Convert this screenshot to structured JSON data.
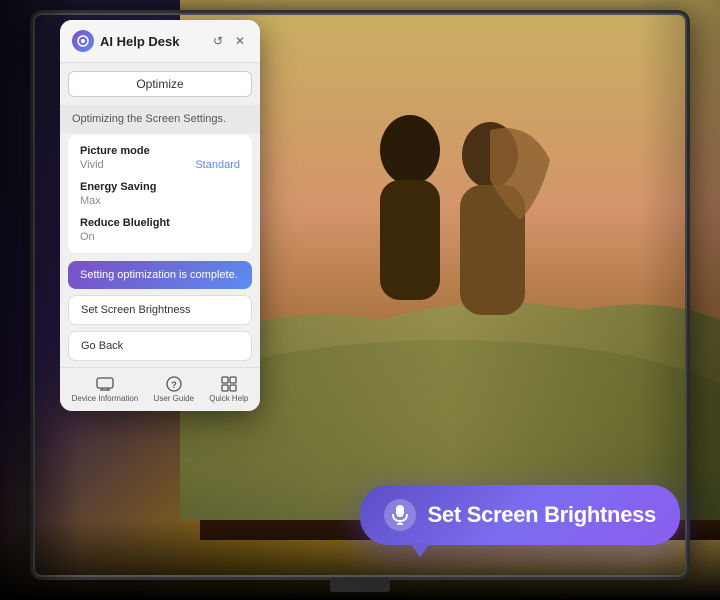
{
  "app": {
    "title": "AI Help Desk",
    "optimize_button": "Optimize",
    "optimizing_text": "Optimizing the Screen Settings.",
    "optimization_complete_text": "Setting optimization is complete."
  },
  "settings": [
    {
      "label": "Picture mode",
      "current_value": "Vivid",
      "recommended_value": "Standard"
    },
    {
      "label": "Energy Saving",
      "current_value": "Max",
      "recommended_value": null
    },
    {
      "label": "Reduce Bluelight",
      "current_value": "On",
      "recommended_value": null
    }
  ],
  "actions": [
    {
      "label": "Set Screen Brightness"
    },
    {
      "label": "Go Back"
    }
  ],
  "nav_items": [
    {
      "label": "Device Information",
      "icon": "monitor-icon"
    },
    {
      "label": "User Guide",
      "icon": "question-icon"
    },
    {
      "label": "Quick Help",
      "icon": "grid-icon"
    }
  ],
  "voice_bubble": {
    "text": "Set Screen Brightness",
    "mic_symbol": "🎤"
  },
  "icons": {
    "refresh": "↺",
    "close": "✕"
  }
}
